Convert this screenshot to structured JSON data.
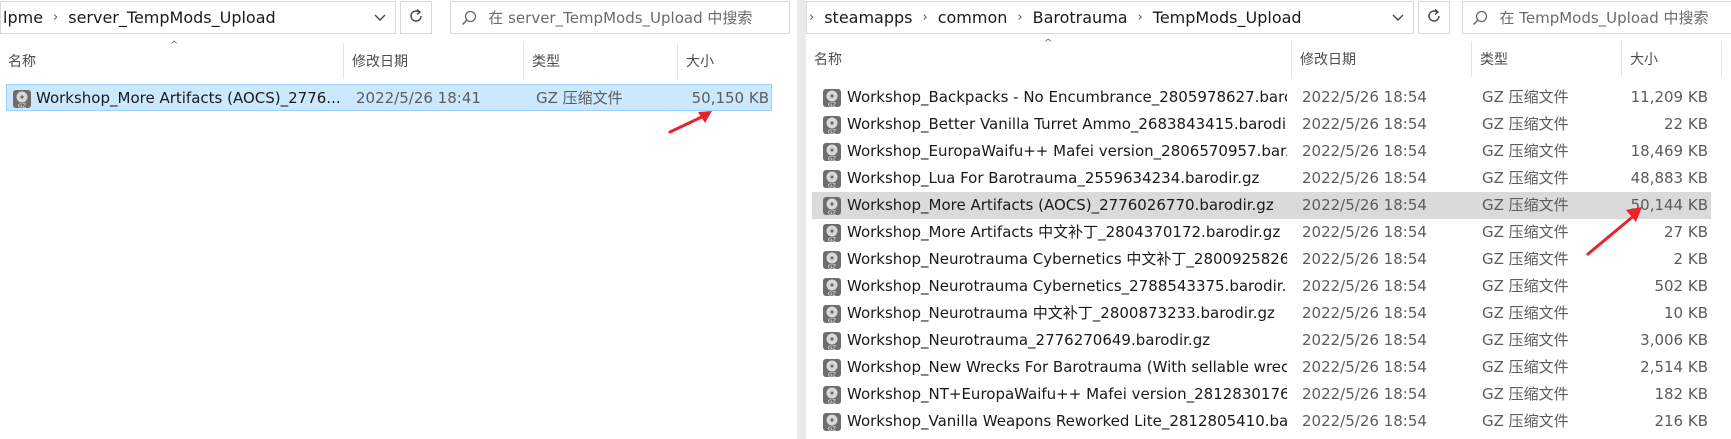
{
  "left": {
    "address": [
      "lpme",
      "server_TempMods_Upload"
    ],
    "search_placeholder": "在 server_TempMods_Upload 中搜索",
    "columns": [
      "名称",
      "修改日期",
      "类型",
      "大小"
    ],
    "files": [
      {
        "name": "Workshop_More Artifacts (AOCS)_2776...",
        "date": "2022/5/26 18:41",
        "type": "GZ 压缩文件",
        "size": "50,150 KB"
      }
    ]
  },
  "right": {
    "address": [
      "steamapps",
      "common",
      "Barotrauma",
      "TempMods_Upload"
    ],
    "search_placeholder": "在 TempMods_Upload 中搜索",
    "columns": [
      "名称",
      "修改日期",
      "类型",
      "大小"
    ],
    "files": [
      {
        "name": "Workshop_Backpacks - No Encumbrance_2805978627.baro...",
        "date": "2022/5/26 18:54",
        "type": "GZ 压缩文件",
        "size": "11,209 KB"
      },
      {
        "name": "Workshop_Better Vanilla Turret Ammo_2683843415.barodi...",
        "date": "2022/5/26 18:54",
        "type": "GZ 压缩文件",
        "size": "22 KB"
      },
      {
        "name": "Workshop_EuropaWaifu++ Mafei version_2806570957.bar...",
        "date": "2022/5/26 18:54",
        "type": "GZ 压缩文件",
        "size": "18,469 KB"
      },
      {
        "name": "Workshop_Lua For Barotrauma_2559634234.barodir.gz",
        "date": "2022/5/26 18:54",
        "type": "GZ 压缩文件",
        "size": "48,883 KB"
      },
      {
        "name": "Workshop_More Artifacts (AOCS)_2776026770.barodir.gz",
        "date": "2022/5/26 18:54",
        "type": "GZ 压缩文件",
        "size": "50,144 KB"
      },
      {
        "name": "Workshop_More Artifacts 中文补丁_2804370172.barodir.gz",
        "date": "2022/5/26 18:54",
        "type": "GZ 压缩文件",
        "size": "27 KB"
      },
      {
        "name": "Workshop_Neurotrauma Cybernetics 中文补丁_2800925826...",
        "date": "2022/5/26 18:54",
        "type": "GZ 压缩文件",
        "size": "2 KB"
      },
      {
        "name": "Workshop_Neurotrauma Cybernetics_2788543375.barodir....",
        "date": "2022/5/26 18:54",
        "type": "GZ 压缩文件",
        "size": "502 KB"
      },
      {
        "name": "Workshop_Neurotrauma 中文补丁_2800873233.barodir.gz",
        "date": "2022/5/26 18:54",
        "type": "GZ 压缩文件",
        "size": "10 KB"
      },
      {
        "name": "Workshop_Neurotrauma_2776270649.barodir.gz",
        "date": "2022/5/26 18:54",
        "type": "GZ 压缩文件",
        "size": "3,006 KB"
      },
      {
        "name": "Workshop_New Wrecks For Barotrauma (With sellable wrec...",
        "date": "2022/5/26 18:54",
        "type": "GZ 压缩文件",
        "size": "2,514 KB"
      },
      {
        "name": "Workshop_NT+EuropaWaifu++ Mafei version_2812830176...",
        "date": "2022/5/26 18:54",
        "type": "GZ 压缩文件",
        "size": "182 KB"
      },
      {
        "name": "Workshop_Vanilla Weapons Reworked Lite_2812805410.ba...",
        "date": "2022/5/26 18:54",
        "type": "GZ 压缩文件",
        "size": "216 KB"
      }
    ]
  },
  "colors": {
    "selected": "#cce8ff",
    "hover": "#dadada",
    "annotation": "#e8232a"
  },
  "icons": {
    "file": "gz-archive-icon",
    "search": "search-icon",
    "refresh": "refresh-icon",
    "dropdown": "chevron-down-icon"
  }
}
